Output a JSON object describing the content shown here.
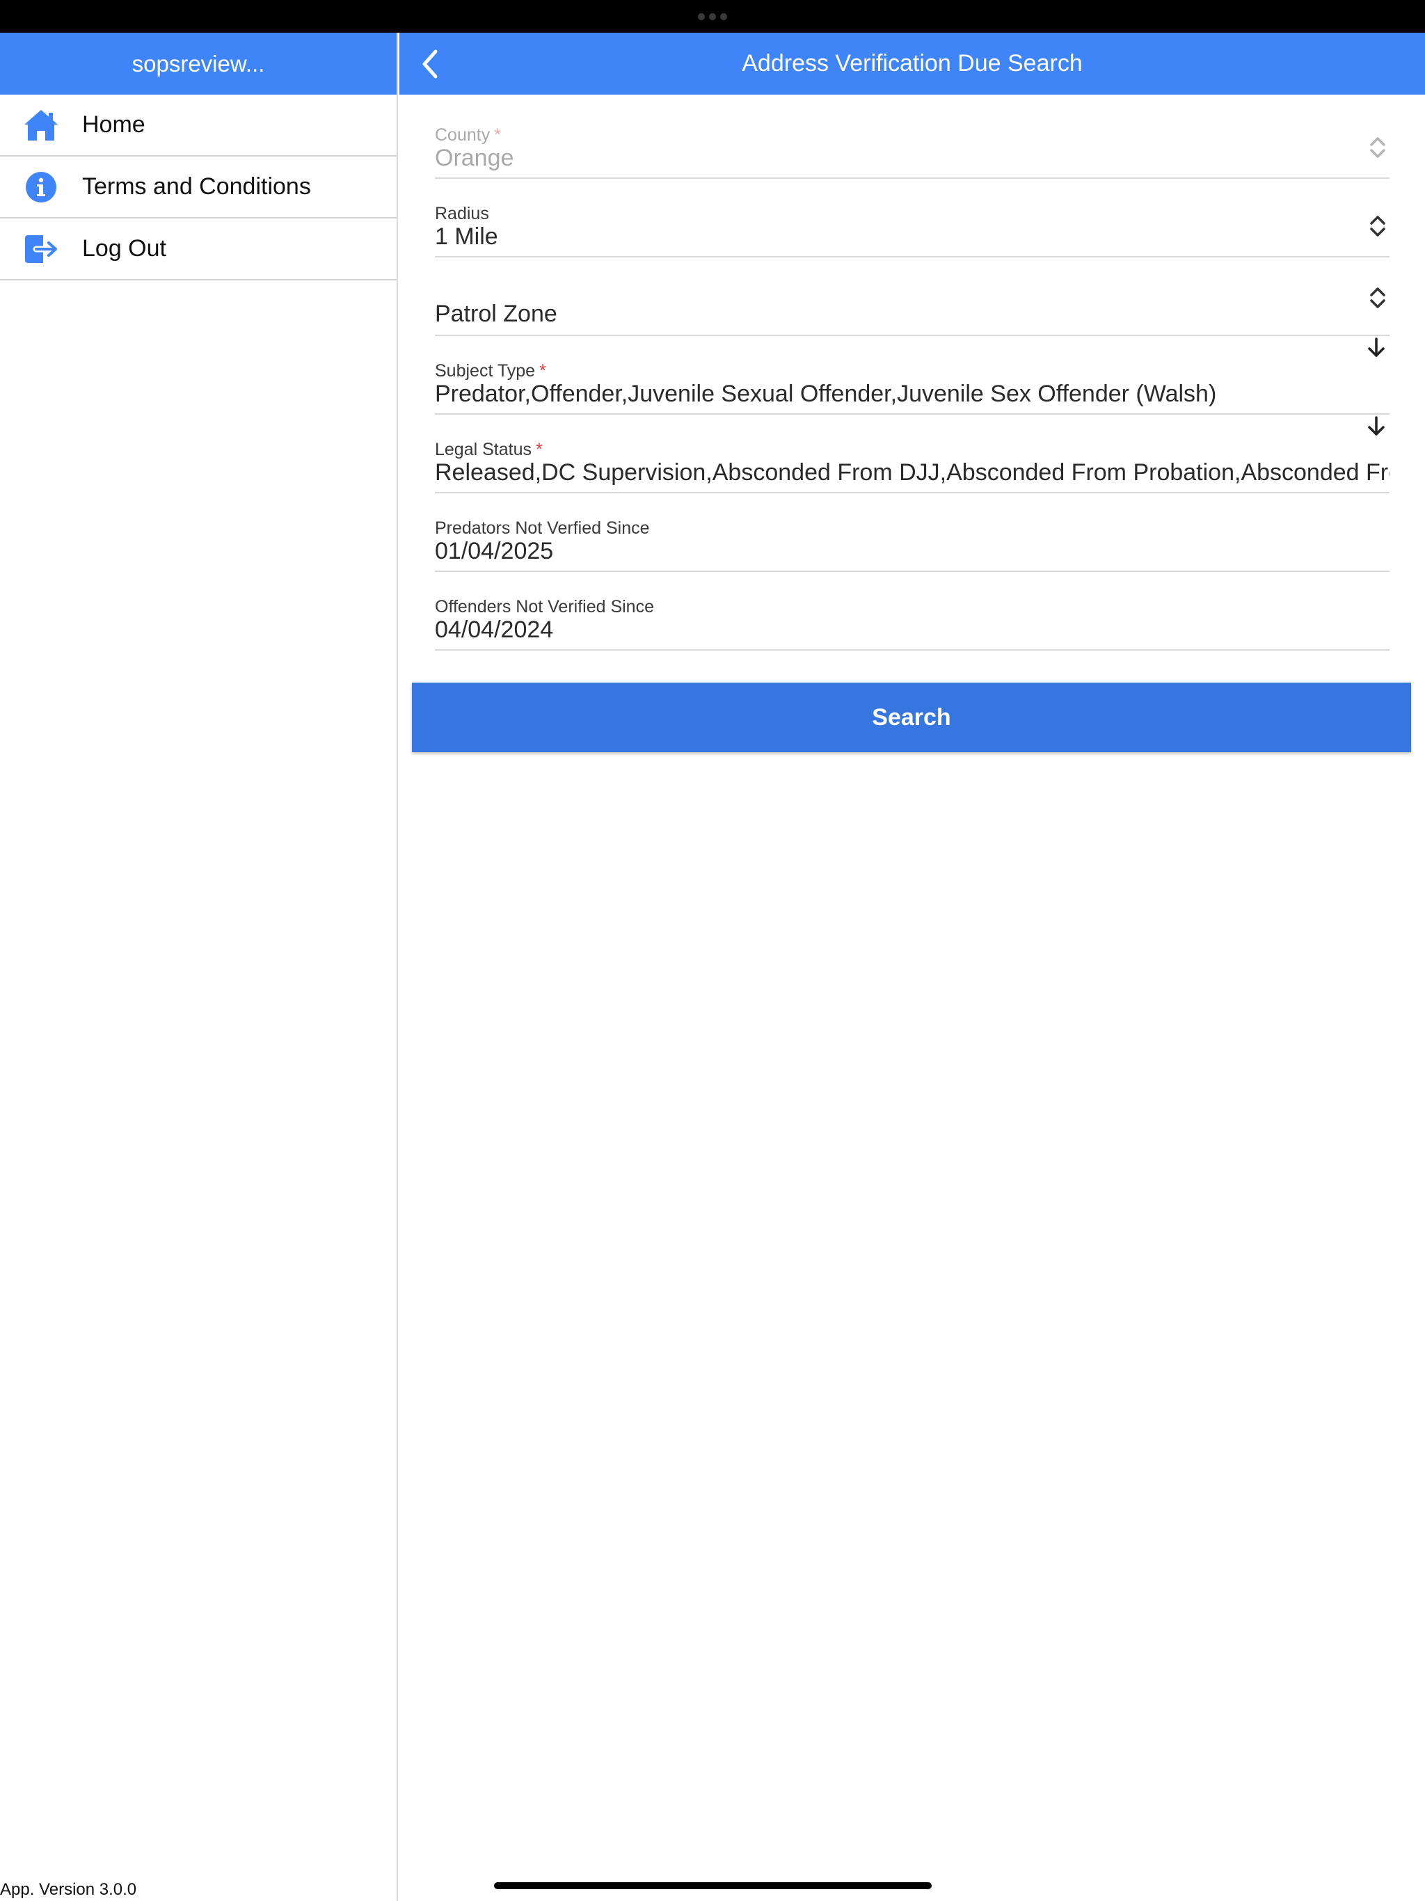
{
  "colors": {
    "header_blue": "#3f85f7",
    "button_blue": "#3676e0",
    "required": "#e23b3b"
  },
  "sidebar": {
    "title": "sopsreview...",
    "items": [
      {
        "label": "Home",
        "icon": "home-icon"
      },
      {
        "label": "Terms and Conditions",
        "icon": "info-icon"
      },
      {
        "label": "Log Out",
        "icon": "logout-icon"
      }
    ],
    "app_version": "App. Version 3.0.0"
  },
  "header": {
    "title": "Address Verification Due Search",
    "back_icon": "chevron-left-icon"
  },
  "form": {
    "county": {
      "label": "County",
      "required": "*",
      "value": "Orange"
    },
    "radius": {
      "label": "Radius",
      "value": "1 Mile"
    },
    "patrol_zone": {
      "placeholder": "Patrol Zone"
    },
    "subject_type": {
      "label": "Subject Type",
      "required": "*",
      "value": "Predator,Offender,Juvenile Sexual Offender,Juvenile Sex Offender (Walsh)"
    },
    "legal_status": {
      "label": "Legal Status",
      "required": "*",
      "value": "Released,DC Supervision,Absconded From DJJ,Absconded From Probation,Absconded From Supervision"
    },
    "predators_not_verified": {
      "label": "Predators Not Verfied Since",
      "value": "01/04/2025"
    },
    "offenders_not_verified": {
      "label": "Offenders Not Verified Since",
      "value": "04/04/2024"
    }
  },
  "search_button": {
    "label": "Search"
  }
}
